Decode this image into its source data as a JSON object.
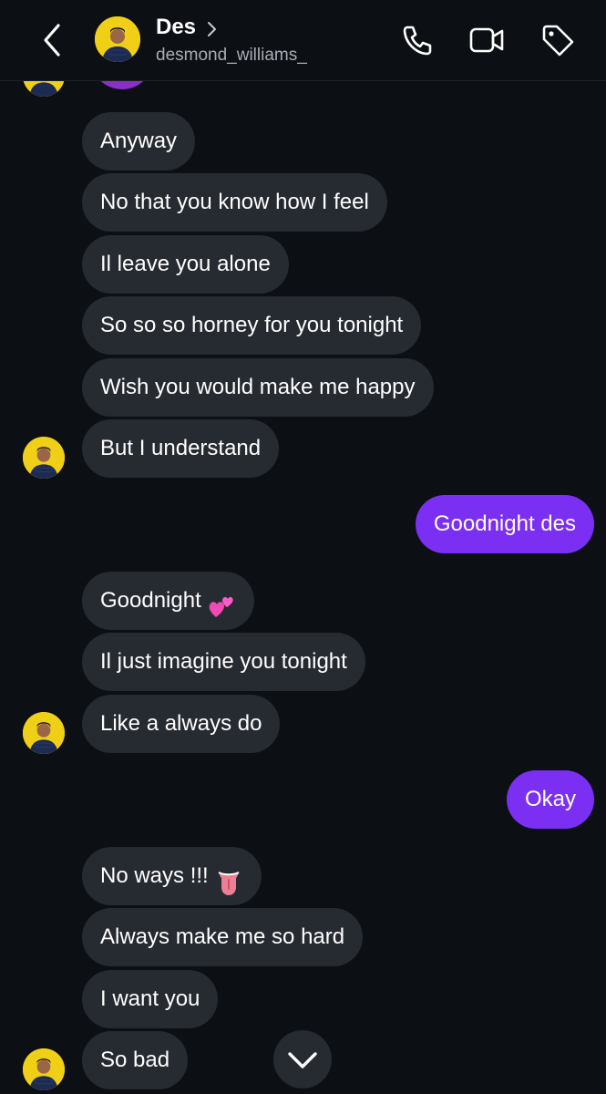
{
  "header": {
    "name": "Des",
    "username": "desmond_williams_"
  },
  "messages": [
    {
      "dir": "in",
      "text": "Anyway"
    },
    {
      "dir": "in",
      "text": "No that you know how I feel"
    },
    {
      "dir": "in",
      "text": "Il leave you alone"
    },
    {
      "dir": "in",
      "text": "So so so horney for you tonight"
    },
    {
      "dir": "in",
      "text": "Wish you would make me happy"
    },
    {
      "dir": "in",
      "text": "But I understand"
    },
    {
      "dir": "out",
      "text": "Goodnight des"
    },
    {
      "dir": "in",
      "text": "Goodnight",
      "emoji": "two-hearts-icon"
    },
    {
      "dir": "in",
      "text": "Il just imagine you tonight"
    },
    {
      "dir": "in",
      "text": "Like a always do"
    },
    {
      "dir": "out",
      "text": "Okay"
    },
    {
      "dir": "in",
      "text": "No ways !!!",
      "emoji": "tongue-icon"
    },
    {
      "dir": "in",
      "text": "Always make me so hard"
    },
    {
      "dir": "in",
      "text": "I want you"
    },
    {
      "dir": "in",
      "text": "So bad"
    }
  ],
  "colors": {
    "background": "#0c0f14",
    "incoming_bubble": "#262a31",
    "outgoing_bubble": "#7b2ff2",
    "avatar_bg": "#f0cf17"
  },
  "icons": [
    "back-chevron-icon",
    "phone-icon",
    "video-camera-icon",
    "tag-icon",
    "chevron-down-icon"
  ]
}
